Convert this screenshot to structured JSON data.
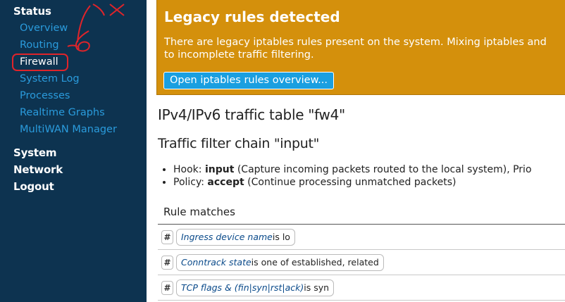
{
  "sidebar": {
    "sections": [
      {
        "label": "Status"
      },
      {
        "label": "System"
      },
      {
        "label": "Network"
      },
      {
        "label": "Logout"
      }
    ],
    "status_items": [
      {
        "label": "Overview"
      },
      {
        "label": "Routing"
      },
      {
        "label": "Firewall",
        "active": true
      },
      {
        "label": "System Log"
      },
      {
        "label": "Processes"
      },
      {
        "label": "Realtime Graphs"
      },
      {
        "label": "MultiWAN Manager"
      }
    ]
  },
  "alert": {
    "title": "Legacy rules detected",
    "line1": "There are legacy iptables rules present on the system. Mixing iptables and",
    "line2": "to incomplete traffic filtering.",
    "button_label": "Open iptables rules overview..."
  },
  "table_heading": "IPv4/IPv6 traffic table \"fw4\"",
  "chain_heading": "Traffic filter chain \"input\"",
  "meta": {
    "hook_label": "Hook: ",
    "hook_value": "input",
    "hook_desc": " (Capture incoming packets routed to the local system), Prio",
    "policy_label": "Policy: ",
    "policy_value": "accept",
    "policy_desc": " (Continue processing unmatched packets)"
  },
  "rules": {
    "header": "Rule matches",
    "hash_label": "#",
    "rows": [
      {
        "field": "Ingress device name",
        "rest": "is lo"
      },
      {
        "field": "Conntrack state",
        "rest": "is one of established, related"
      },
      {
        "field": "TCP flags & (fin|syn|rst|ack)",
        "rest": "is syn"
      }
    ]
  },
  "colors": {
    "sidebar_bg": "#0d3350",
    "link": "#2a9bdc",
    "alert_bg": "#d4900c",
    "button_bg": "#1a9fe0",
    "annotation": "#e0242a"
  }
}
